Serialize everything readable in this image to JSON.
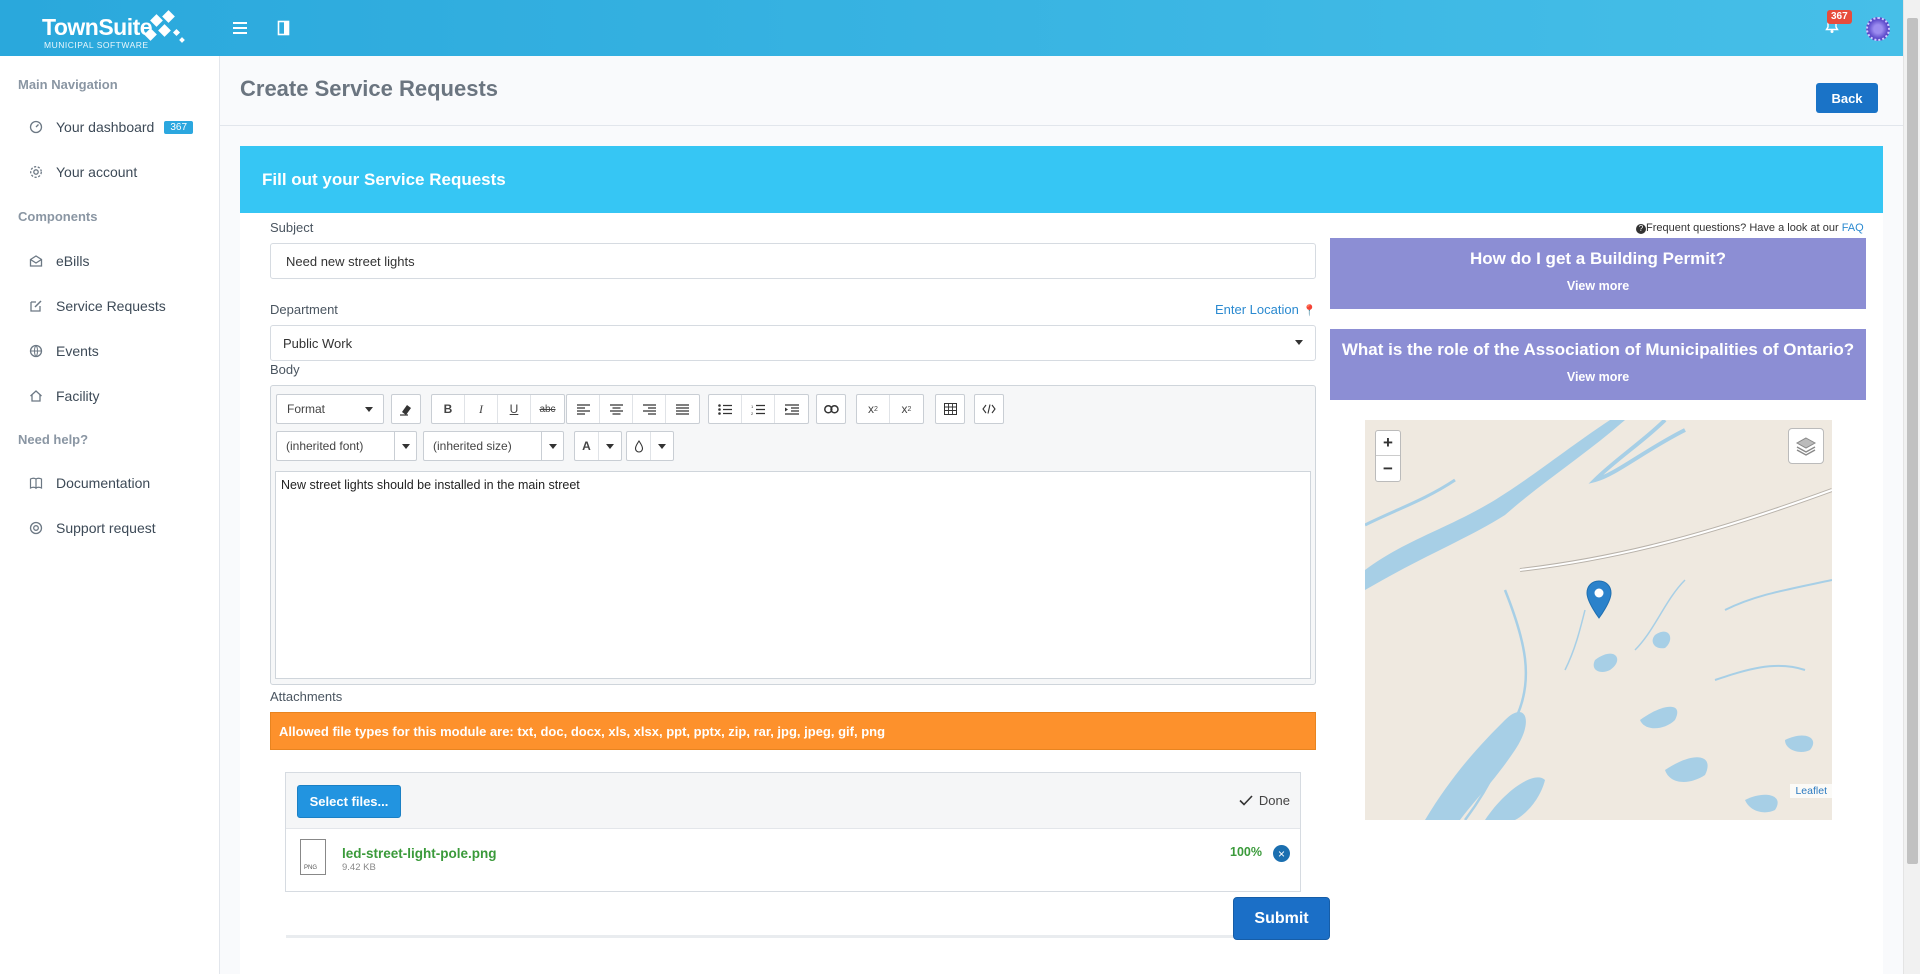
{
  "header": {
    "brand": "TownSuite",
    "brand_sub": "MUNICIPAL SOFTWARE",
    "notification_count": "367"
  },
  "sidebar": {
    "sections": [
      {
        "heading": "Main Navigation"
      },
      {
        "heading": "Components"
      },
      {
        "heading": "Need help?"
      }
    ],
    "items": [
      {
        "label": "Your dashboard",
        "badge": "367",
        "icon": "dashboard-icon"
      },
      {
        "label": "Your account",
        "icon": "gear-icon"
      },
      {
        "label": "eBills",
        "icon": "envelope-icon"
      },
      {
        "label": "Service Requests",
        "icon": "edit-icon"
      },
      {
        "label": "Events",
        "icon": "globe-icon"
      },
      {
        "label": "Facility",
        "icon": "home-icon"
      },
      {
        "label": "Documentation",
        "icon": "book-icon"
      },
      {
        "label": "Support request",
        "icon": "lifebuoy-icon"
      }
    ]
  },
  "page": {
    "title": "Create Service Requests",
    "back_label": "Back",
    "panel_title": "Fill out your Service Requests"
  },
  "form": {
    "subject_label": "Subject",
    "subject_value": "Need new street lights",
    "department_label": "Department",
    "department_value": "Public Work",
    "enter_location": "Enter Location",
    "body_label": "Body",
    "body_text": "New street lights should be installed in the main street",
    "toolbar": {
      "format_label": "Format",
      "font_label": "(inherited font)",
      "size_label": "(inherited size)"
    },
    "attachments_label": "Attachments",
    "allowed_types": "Allowed file types for this module are: txt, doc, docx, xls, xlsx, ppt, pptx, zip, rar, jpg, jpeg, gif, png",
    "select_files_label": "Select files...",
    "done_label": "Done",
    "file": {
      "name": "led-street-light-pole.png",
      "size": "9.42 KB",
      "ext": "PNG",
      "progress": "100%"
    },
    "submit_label": "Submit"
  },
  "faq": {
    "intro": "Frequent questions? Have a look at our",
    "link": "FAQ",
    "cards": [
      {
        "question": "How do I get a Building Permit?",
        "more": "View more"
      },
      {
        "question": "What is the role of the Association of Municipalities of Ontario?",
        "more": "View more"
      }
    ]
  },
  "map": {
    "zoom_in": "+",
    "zoom_out": "−",
    "attribution": "Leaflet"
  },
  "colors": {
    "topbar": "#2aa8dc",
    "panel_header": "#36c6f4",
    "faq_card": "#8c8ed4",
    "warning": "#fd912c",
    "primary": "#1b6fc7",
    "success": "#3a9a3a"
  }
}
